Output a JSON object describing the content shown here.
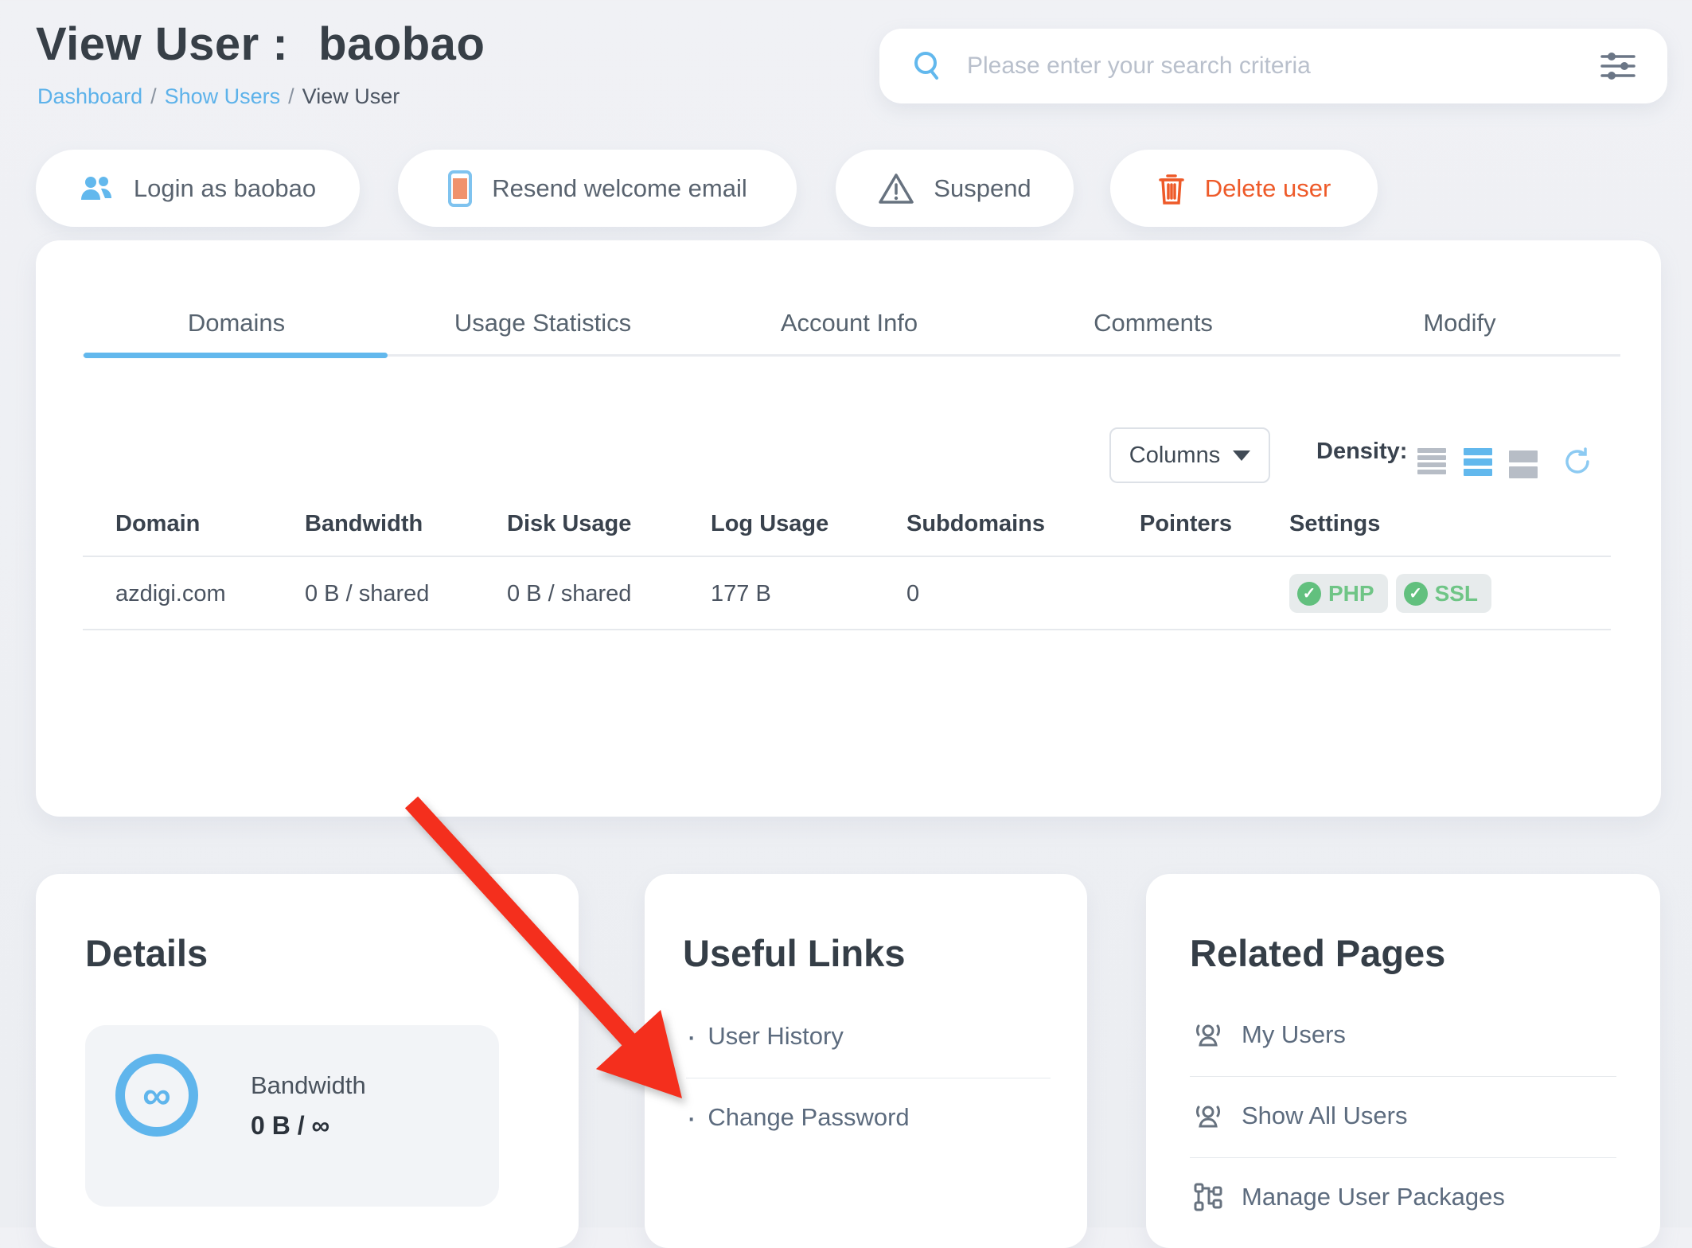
{
  "page": {
    "title_label": "View User :",
    "title_value": "baobao"
  },
  "breadcrumb": {
    "separator": "/",
    "items": [
      {
        "label": "Dashboard"
      },
      {
        "label": "Show Users"
      },
      {
        "label": "View User"
      }
    ]
  },
  "search": {
    "placeholder": "Please enter your search criteria"
  },
  "actions": {
    "login": "Login as baobao",
    "resend": "Resend welcome email",
    "suspend": "Suspend",
    "delete": "Delete user"
  },
  "tabs": [
    {
      "label": "Domains",
      "active": true
    },
    {
      "label": "Usage Statistics",
      "active": false
    },
    {
      "label": "Account Info",
      "active": false
    },
    {
      "label": "Comments",
      "active": false
    },
    {
      "label": "Modify",
      "active": false
    }
  ],
  "table_controls": {
    "columns_label": "Columns",
    "density_label": "Density:"
  },
  "domains_table": {
    "headers": [
      "Domain",
      "Bandwidth",
      "Disk Usage",
      "Log Usage",
      "Subdomains",
      "Pointers",
      "Settings"
    ],
    "rows": [
      {
        "domain": "azdigi.com",
        "bandwidth": "0 B / shared",
        "disk_usage": "0 B / shared",
        "log_usage": "177 B",
        "subdomains": "0",
        "pointers": "",
        "settings": [
          "PHP",
          "SSL"
        ]
      }
    ]
  },
  "details_card": {
    "title": "Details",
    "stat": {
      "label": "Bandwidth",
      "value": "0 B / ∞",
      "icon_glyph": "∞"
    }
  },
  "useful_links_card": {
    "title": "Useful Links",
    "bullet": "·",
    "links": [
      {
        "label": "User History"
      },
      {
        "label": "Change Password"
      }
    ]
  },
  "related_pages_card": {
    "title": "Related Pages",
    "links": [
      {
        "label": "My Users",
        "icon": "users-icon"
      },
      {
        "label": "Show All Users",
        "icon": "users-icon"
      },
      {
        "label": "Manage User Packages",
        "icon": "packages-icon"
      }
    ]
  },
  "colors": {
    "accent_blue": "#62b8ed",
    "danger_orange": "#ee5a29",
    "badge_green": "#62c07e",
    "arrow_red": "#f42f1d"
  }
}
